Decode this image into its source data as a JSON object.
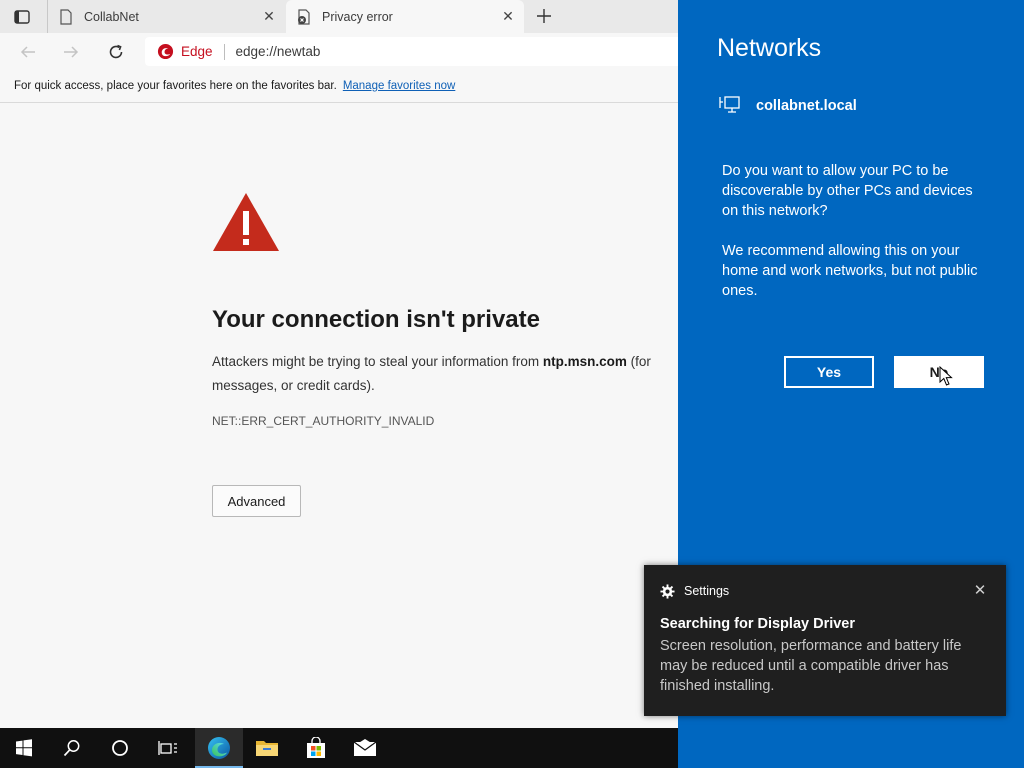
{
  "browser": {
    "tabs": [
      {
        "title": "CollabNet"
      },
      {
        "title": "Privacy error"
      }
    ],
    "address": {
      "brand": "Edge",
      "url": "edge://newtab"
    },
    "favorites_bar": {
      "message": "For quick access, place your favorites here on the favorites bar.",
      "link": "Manage favorites now"
    },
    "error": {
      "title": "Your connection isn't private",
      "body_prefix": "Attackers might be trying to steal your information from ",
      "body_domain": "ntp.msn.com",
      "body_suffix": " (for",
      "body_line2": "messages, or credit cards).",
      "code": "NET::ERR_CERT_AUTHORITY_INVALID",
      "advanced_label": "Advanced"
    }
  },
  "networks": {
    "title": "Networks",
    "network_name": "collabnet.local",
    "question": "Do you want to allow your PC to be discoverable by other PCs and devices on this network?",
    "recommendation": "We recommend allowing this on your home and work networks, but not public ones.",
    "yes_label": "Yes",
    "no_label": "No"
  },
  "toast": {
    "app": "Settings",
    "title": "Searching for Display Driver",
    "body": "Screen resolution, performance and battery life may be reduced until a compatible driver has finished installing."
  },
  "taskbar": {
    "items": [
      "start-icon",
      "search-icon",
      "task-view-icon",
      "timeline-icon",
      "edge-icon",
      "file-explorer-icon",
      "store-icon",
      "mail-icon"
    ],
    "active": "edge-icon"
  },
  "colors": {
    "flyout_blue": "#0067c0",
    "error_red": "#c42b1c",
    "link_blue": "#0f60b6",
    "edge_red": "#c50f1f",
    "toast_bg": "#1f1f1f",
    "taskbar_bg": "#101010"
  }
}
